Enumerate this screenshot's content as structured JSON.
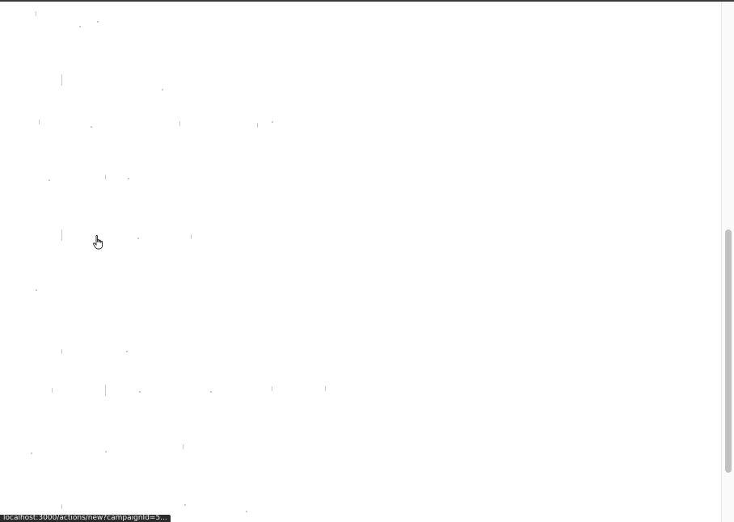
{
  "page": {
    "background": "#ffffff",
    "scrollbar_thumb_color": "#c1c1c1"
  },
  "cursor": {
    "icon": "hand-pointer-icon"
  },
  "status_bar": {
    "url": "localhost:3000/actions/new?campaignId=5..."
  },
  "scroll": {
    "thumb_position_fraction": 0.44,
    "thumb_size_fraction": 0.47
  }
}
